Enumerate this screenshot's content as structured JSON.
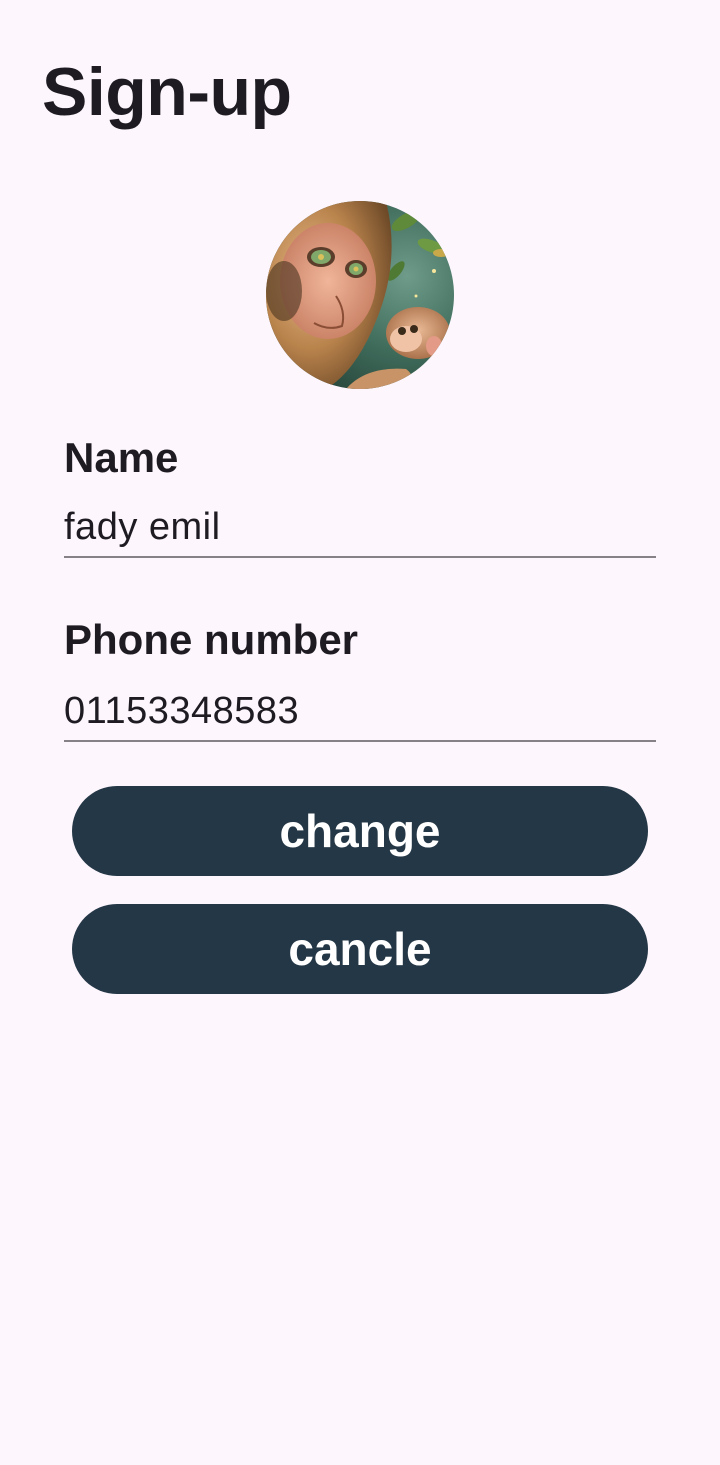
{
  "page": {
    "title": "Sign-up"
  },
  "avatar": {
    "description_icon": "profile-photo-monkeys"
  },
  "form": {
    "name_label": "Name",
    "name_value": "fady emil",
    "phone_label": "Phone number",
    "phone_value": "01153348583"
  },
  "buttons": {
    "change_label": "change",
    "cancel_label": "cancle"
  },
  "colors": {
    "background": "#fdf6fd",
    "button": "#243746",
    "button_text": "#ffffff",
    "text": "#1e1b22",
    "underline": "#858186"
  }
}
